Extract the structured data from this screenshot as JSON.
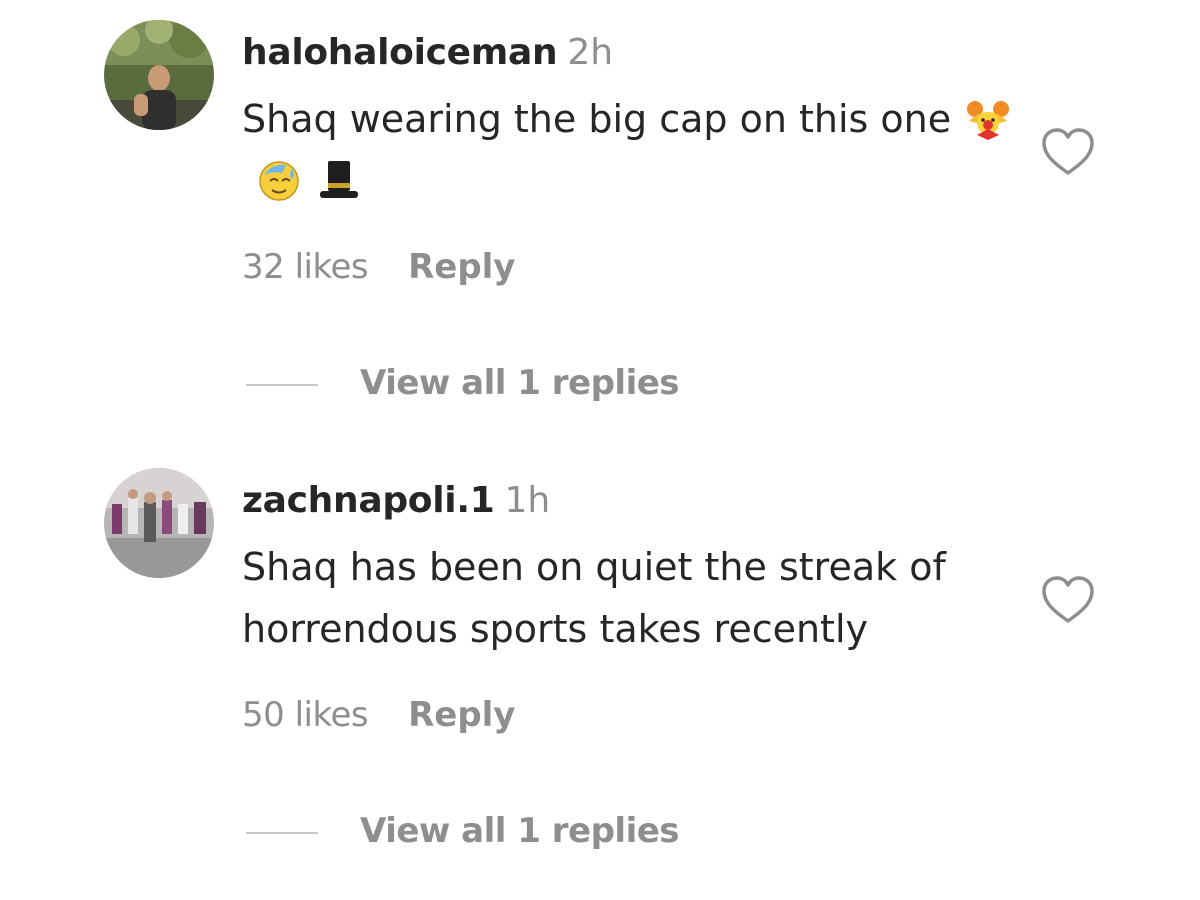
{
  "comments": [
    {
      "username": "halohaloiceman",
      "time": "2h",
      "text": "Shaq wearing the big cap on this one",
      "emojis": [
        "clown-face-emoji",
        "sweat-face-emoji",
        "top-hat-emoji"
      ],
      "likes": "32 likes",
      "reply_label": "Reply",
      "view_replies": "View all 1 replies"
    },
    {
      "username": "zachnapoli.1",
      "time": "1h",
      "text": "Shaq has been on quiet the streak of horrendous sports takes recently",
      "likes": "50 likes",
      "reply_label": "Reply",
      "view_replies": "View all 1 replies"
    }
  ],
  "colors": {
    "text_primary": "#262626",
    "text_secondary": "#8e8e8e",
    "divider": "#c7c7c7"
  }
}
